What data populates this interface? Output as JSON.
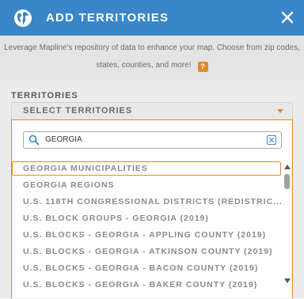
{
  "header": {
    "title": "ADD TERRITORIES",
    "icon": "globe-icon",
    "close_icon": "close-icon",
    "background": "#3a86c8"
  },
  "description": {
    "line1": "Leverage Mapline's repository of data to enhance your map. Choose from zip codes,",
    "line2": "states, counties, and more!",
    "help_label": "?",
    "help_color": "#e3892c"
  },
  "territories": {
    "label": "TERRITORIES",
    "select_placeholder": "SELECT TERRITORIES",
    "search": {
      "value": "GEORGIA",
      "icon": "search-icon",
      "clear_icon": "clear-icon"
    },
    "options": [
      "GEORGIA MUNICIPALITIES",
      "GEORGIA REGIONS",
      "U.S. 118TH CONGRESSIONAL DISTRICTS (REDISTRIC...",
      "U.S. BLOCK GROUPS - GEORGIA (2019)",
      "U.S. BLOCKS - GEORGIA - APPLING COUNTY (2019)",
      "U.S. BLOCKS - GEORGIA - ATKINSON COUNTY (2019)",
      "U.S. BLOCKS - GEORGIA - BACON COUNTY (2019)",
      "U.S. BLOCKS - GEORGIA - BAKER COUNTY (2019)"
    ],
    "active_option_index": 0
  }
}
